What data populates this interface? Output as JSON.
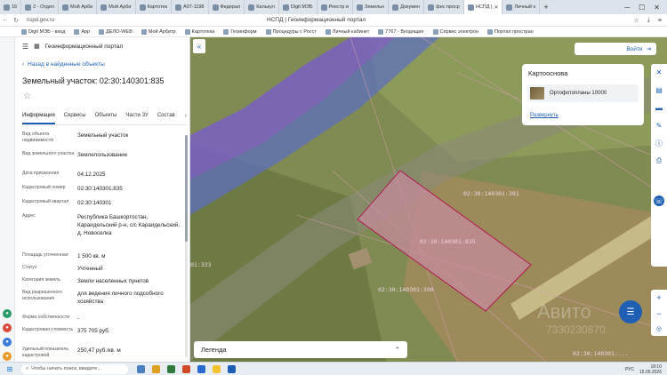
{
  "browser": {
    "tabs": [
      {
        "label": "16",
        "active": false
      },
      {
        "label": "2 - Отдел",
        "active": false
      },
      {
        "label": "Мой Арби",
        "active": false
      },
      {
        "label": "Мой Арби",
        "active": false
      },
      {
        "label": "Картотек",
        "active": false
      },
      {
        "label": "А07-1198",
        "active": false
      },
      {
        "label": "Федерал",
        "active": false
      },
      {
        "label": "Калькул",
        "active": false
      },
      {
        "label": "Digit МЭБ",
        "active": false
      },
      {
        "label": "Реестр и",
        "active": false
      },
      {
        "label": "Земельн",
        "active": false
      },
      {
        "label": "Докумен",
        "active": false
      },
      {
        "label": "фнс проср",
        "active": false
      },
      {
        "label": "НСПД |",
        "active": true
      },
      {
        "label": "Личный к",
        "active": false
      }
    ],
    "new_tab": "+",
    "url": "nspd.gov.ru",
    "page_title": "НСПД | Геоинформационный портал",
    "bookmarks": [
      "Digit МЭБ - вход",
      "App",
      "ДЕЛО-WEB",
      "Мой Арбитр",
      "Картотека",
      "Геоинформ",
      "Процедуры с Росст",
      "Личный кабинет",
      "7767 - Входящие",
      "Сервис электрон",
      "Портал простран"
    ]
  },
  "panel": {
    "portal_title": "Геоинформационный портал",
    "back_link": "Назад в найденные объекты",
    "parcel_title": "Земельный участок: 02:30:140301:835",
    "tabs": [
      "Информация",
      "Сервисы",
      "Объекты",
      "Части ЗУ",
      "Состав"
    ],
    "info_rows": [
      {
        "key": "Вид объекта недвижимости",
        "value": "Земельный участок"
      },
      {
        "key": "Вид земельного участка",
        "value": "Землепользование"
      },
      {
        "key": "Дата присвоения",
        "value": "04.12.2025"
      },
      {
        "key": "Кадастровый номер",
        "value": "02:30:140301:835"
      },
      {
        "key": "Кадастровый квартал",
        "value": "02:30:140301"
      },
      {
        "key": "Адрес",
        "value": "Республика Башкортостан, Караидельский р-н, с/с Караидельский, д. Новоселка"
      },
      {
        "key": "Площадь уточненная",
        "value": "1 500 кв. м"
      },
      {
        "key": "Статус",
        "value": "Учтенный"
      },
      {
        "key": "Категория земель",
        "value": "Земли населенных пунктов"
      },
      {
        "key": "Вид разрешенного использования",
        "value": "для ведения личного подсобного хозяйства"
      },
      {
        "key": "Форма собственности",
        "value": "-"
      },
      {
        "key": "Кадастровая стоимость",
        "value": "375 705 руб."
      },
      {
        "key": "Удельный показатель кадастровой",
        "value": "250,47 руб./кв. м"
      }
    ]
  },
  "map": {
    "login_label": "Войти",
    "basemap": {
      "title": "Картооснова",
      "item": "Ортофотопланы 10000",
      "change": "Развернуть"
    },
    "legend_label": "Легенда",
    "parcel_labels": [
      "02:30:140301:391",
      "02:30:140301:835",
      "02:30:140301:390",
      "01:333",
      "02:30:140301:..."
    ],
    "watermark": "Авито",
    "watermark_id": "7330230870",
    "colors": {
      "parcel_fill": "#c98a9f",
      "parcel_stroke": "#b0104f",
      "zone_purple": "#8a5fc1",
      "zone_blue": "#5f6fb3"
    }
  },
  "taskbar": {
    "search_placeholder": "Чтобы начать поиск, введите...",
    "lang": "РУС",
    "time": "18:10",
    "date": "15.05.2026"
  }
}
